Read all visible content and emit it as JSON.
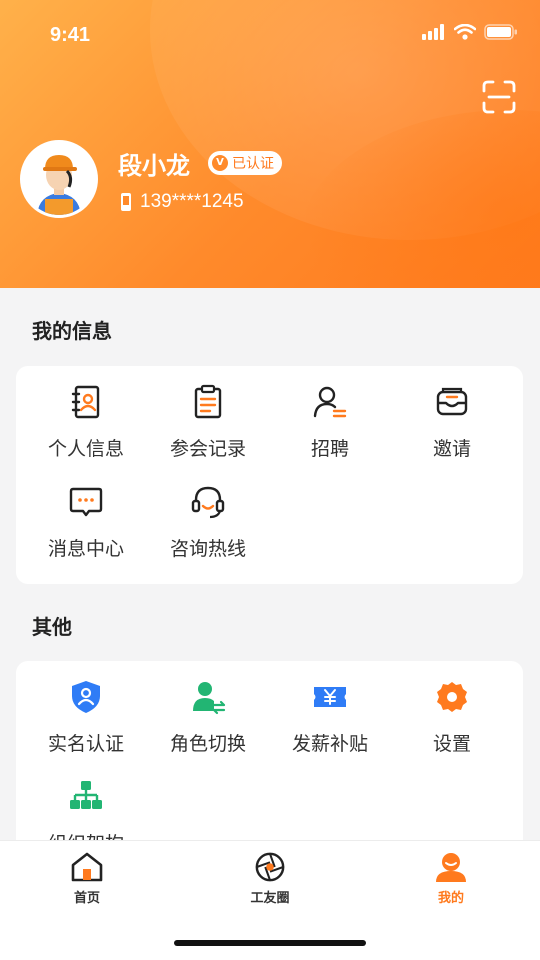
{
  "status": {
    "time": "9:41"
  },
  "profile": {
    "name": "段小龙",
    "verified_label": "已认证",
    "verified_badge": "V",
    "phone": "139****1245"
  },
  "my_info": {
    "title": "我的信息",
    "items": [
      {
        "label": "个人信息",
        "icon": "contact-book-icon"
      },
      {
        "label": "参会记录",
        "icon": "clipboard-icon"
      },
      {
        "label": "招聘",
        "icon": "recruit-person-icon"
      },
      {
        "label": "邀请",
        "icon": "invite-envelope-icon"
      },
      {
        "label": "消息中心",
        "icon": "message-bubble-icon"
      },
      {
        "label": "咨询热线",
        "icon": "headset-icon"
      }
    ]
  },
  "others": {
    "title": "其他",
    "items": [
      {
        "label": "实名认证",
        "icon": "shield-user-icon"
      },
      {
        "label": "角色切换",
        "icon": "role-switch-icon"
      },
      {
        "label": "发薪补贴",
        "icon": "yuan-ticket-icon"
      },
      {
        "label": "设置",
        "icon": "gear-icon"
      },
      {
        "label": "组织架构",
        "icon": "org-chart-icon"
      }
    ]
  },
  "tabbar": {
    "items": [
      {
        "label": "首页",
        "icon": "home-icon"
      },
      {
        "label": "工友圈",
        "icon": "aperture-icon"
      },
      {
        "label": "我的",
        "icon": "profile-icon",
        "active": true
      }
    ]
  },
  "colors": {
    "accent": "#ff7a1e",
    "accent_light": "#ffb14a",
    "blue": "#2f7cf6",
    "green": "#22b573"
  }
}
